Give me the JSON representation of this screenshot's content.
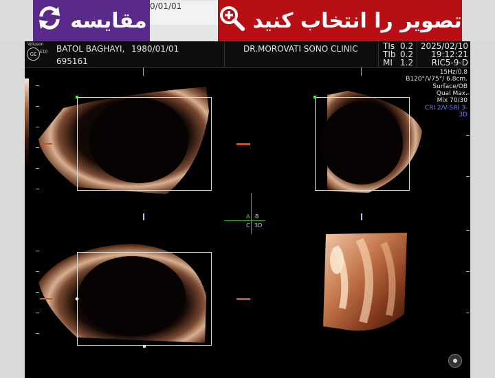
{
  "toolbar": {
    "compare_label": "مقایسه",
    "select_label": "تصویر را انتخاب کنید",
    "ghost_text": "0/01/01"
  },
  "header": {
    "brand": "Voluson",
    "logo": "GE",
    "model": "E10",
    "patient_name": "BATOL BAGHAYI,",
    "birth_date": "1980/01/01",
    "patient_id": "695161",
    "clinic": "DR.MOROVATI SONO CLINIC",
    "tis_label": "TIs",
    "tis_value": "0.2",
    "tib_label": "TIb",
    "tib_value": "0.2",
    "mi_label": "MI",
    "mi_value": "1.2",
    "date": "2025/02/10",
    "time": "19:12:21",
    "probe": "RIC5-9-D"
  },
  "params": {
    "p1": "15Hz/0.8",
    "p2": "B120°/V75°/ 6.8cm.",
    "p3": "Surface/OB",
    "p4": "Qual Max.",
    "p5": "Mix 70/30",
    "p6": "CRI 2/V-SRI 3-",
    "p7": "3D"
  },
  "quad_labels": {
    "a": "A",
    "b": "B",
    "c": "C",
    "d": "3D"
  },
  "icons": {
    "compare": "refresh-icon",
    "select": "zoom-in-icon"
  }
}
